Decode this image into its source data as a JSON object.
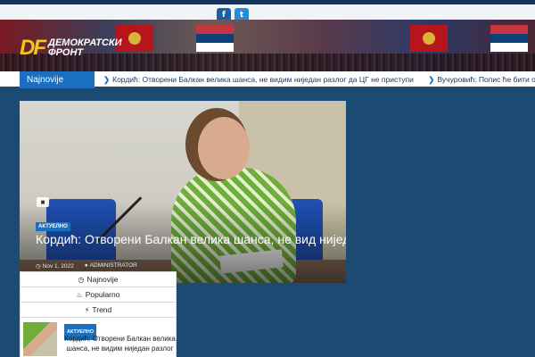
{
  "social": {
    "facebook_icon": "facebook-icon",
    "twitter_icon": "twitter-icon"
  },
  "logo": {
    "mark": "DF",
    "line1": "ДЕМОКРАТСКИ",
    "line2": "ФРОНТ"
  },
  "ticker": {
    "label": "Najnovije",
    "items": [
      "Кордић: Отворени Балкан велика шанса, не видим ниједан разлог да ЦГ не приступи",
      "Вучуровић: Попис ће бити одржан"
    ]
  },
  "hero": {
    "category": "АКТУЕЛНО",
    "title": "Кордић: Отворени Балкан велика шанса, не вид ниједан разлог да ЦГ не присту",
    "date": "Nov 1, 2022",
    "author": "ADMINISTRATOR"
  },
  "tabs": [
    {
      "icon": "clock-icon",
      "label": "Najnovije"
    },
    {
      "icon": "flame-icon",
      "label": "Popularno"
    },
    {
      "icon": "bolt-icon",
      "label": "Trend"
    }
  ],
  "sidebar_post": {
    "category": "АКТУЕЛНО",
    "title": "Кордић: Отворени Балкан велика шанса, не видим ниједан разлог"
  }
}
